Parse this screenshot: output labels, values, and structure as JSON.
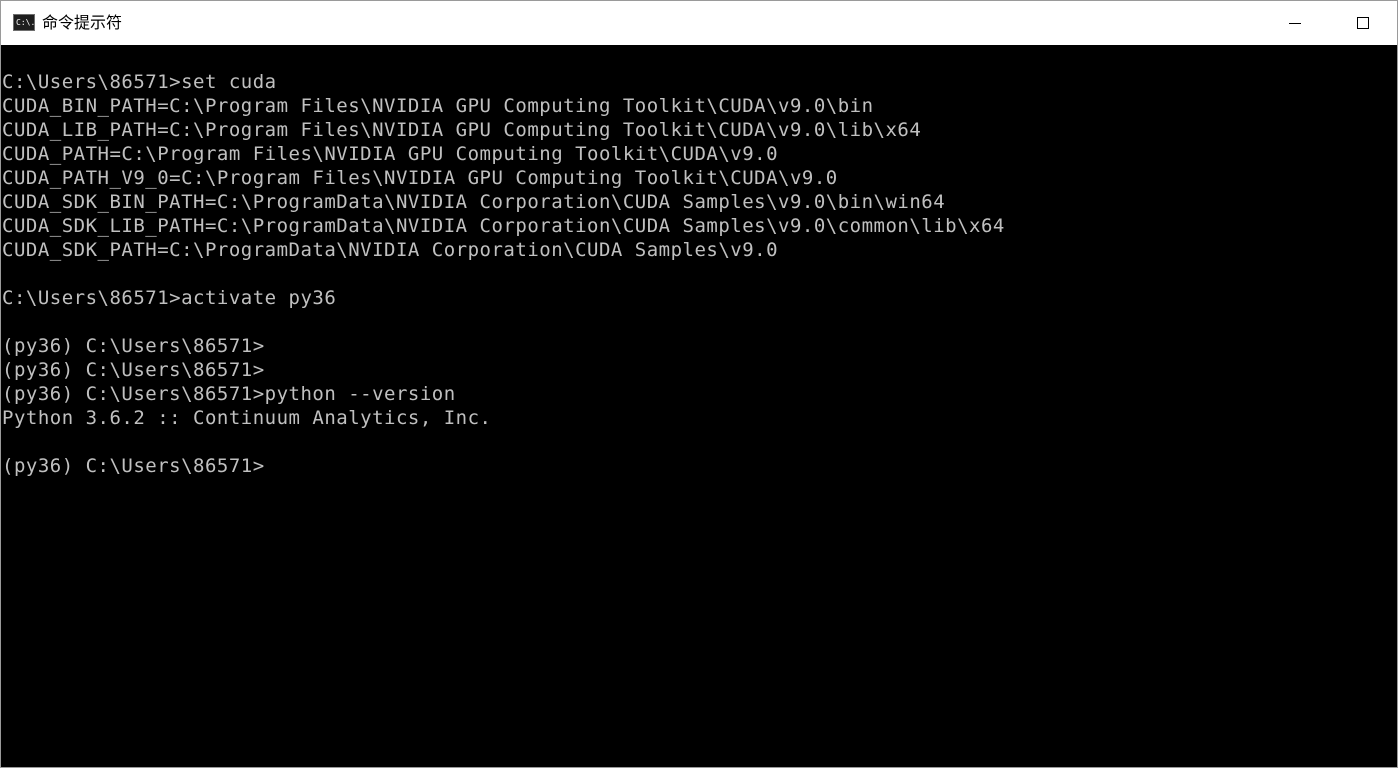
{
  "window": {
    "title": "命令提示符",
    "icon_text": "C:\\."
  },
  "console": {
    "lines": [
      "C:\\Users\\86571>set cuda",
      "CUDA_BIN_PATH=C:\\Program Files\\NVIDIA GPU Computing Toolkit\\CUDA\\v9.0\\bin",
      "CUDA_LIB_PATH=C:\\Program Files\\NVIDIA GPU Computing Toolkit\\CUDA\\v9.0\\lib\\x64",
      "CUDA_PATH=C:\\Program Files\\NVIDIA GPU Computing Toolkit\\CUDA\\v9.0",
      "CUDA_PATH_V9_0=C:\\Program Files\\NVIDIA GPU Computing Toolkit\\CUDA\\v9.0",
      "CUDA_SDK_BIN_PATH=C:\\ProgramData\\NVIDIA Corporation\\CUDA Samples\\v9.0\\bin\\win64",
      "CUDA_SDK_LIB_PATH=C:\\ProgramData\\NVIDIA Corporation\\CUDA Samples\\v9.0\\common\\lib\\x64",
      "CUDA_SDK_PATH=C:\\ProgramData\\NVIDIA Corporation\\CUDA Samples\\v9.0",
      "",
      "C:\\Users\\86571>activate py36",
      "",
      "(py36) C:\\Users\\86571>",
      "(py36) C:\\Users\\86571>",
      "(py36) C:\\Users\\86571>python --version",
      "Python 3.6.2 :: Continuum Analytics, Inc.",
      "",
      "(py36) C:\\Users\\86571>"
    ]
  },
  "colors": {
    "console_bg": "#000000",
    "console_text": "#c0c0c0",
    "titlebar_bg": "#ffffff"
  }
}
